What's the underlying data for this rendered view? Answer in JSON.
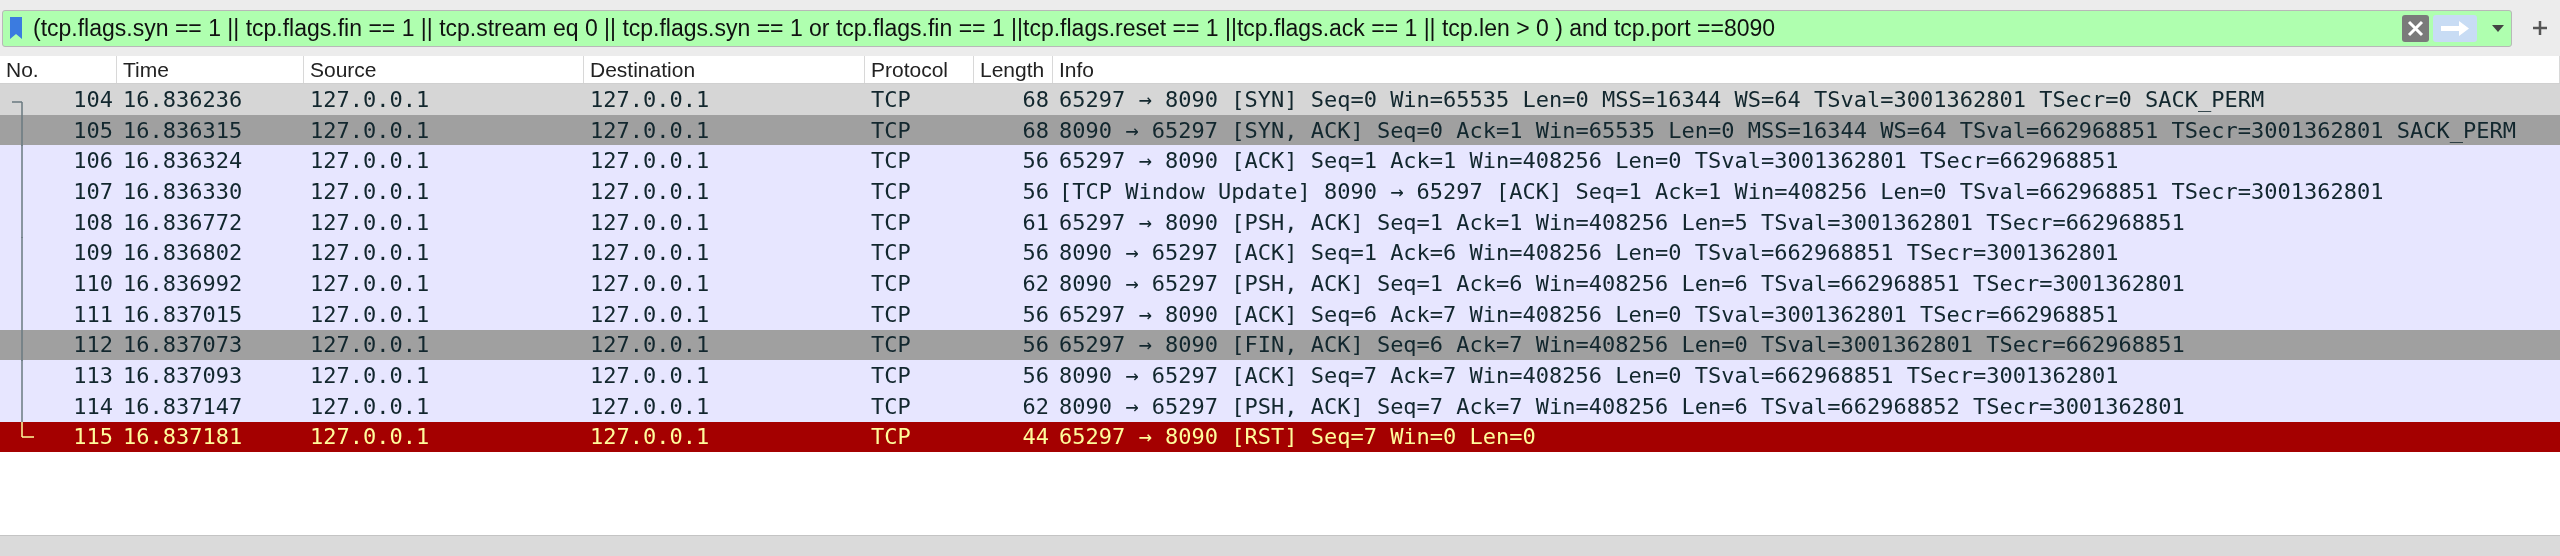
{
  "filter": {
    "value": "(tcp.flags.syn == 1 || tcp.flags.fin == 1 || tcp.stream eq 0 || tcp.flags.syn == 1 or tcp.flags.fin == 1 ||tcp.flags.reset == 1 ||tcp.flags.ack == 1 || tcp.len > 0 ) and tcp.port ==8090",
    "valid": true
  },
  "columns": [
    "No.",
    "Time",
    "Source",
    "Destination",
    "Protocol",
    "Length",
    "Info"
  ],
  "rows": [
    {
      "kind": "syn_fin",
      "hovered": true,
      "cells": [
        "104",
        "16.836236",
        "127.0.0.1",
        "127.0.0.1",
        "TCP",
        "68",
        "65297 → 8090 [SYN] Seq=0 Win=65535 Len=0 MSS=16344 WS=64 TSval=3001362801 TSecr=0 SACK_PERM"
      ]
    },
    {
      "kind": "syn_fin",
      "hovered": false,
      "cells": [
        "105",
        "16.836315",
        "127.0.0.1",
        "127.0.0.1",
        "TCP",
        "68",
        "8090 → 65297 [SYN, ACK] Seq=0 Ack=1 Win=65535 Len=0 MSS=16344 WS=64 TSval=662968851 TSecr=3001362801 SACK_PERM"
      ]
    },
    {
      "kind": "tcp",
      "hovered": false,
      "cells": [
        "106",
        "16.836324",
        "127.0.0.1",
        "127.0.0.1",
        "TCP",
        "56",
        "65297 → 8090 [ACK] Seq=1 Ack=1 Win=408256 Len=0 TSval=3001362801 TSecr=662968851"
      ]
    },
    {
      "kind": "tcp",
      "hovered": false,
      "cells": [
        "107",
        "16.836330",
        "127.0.0.1",
        "127.0.0.1",
        "TCP",
        "56",
        "[TCP Window Update] 8090 → 65297 [ACK] Seq=1 Ack=1 Win=408256 Len=0 TSval=662968851 TSecr=3001362801"
      ]
    },
    {
      "kind": "tcp",
      "hovered": false,
      "cells": [
        "108",
        "16.836772",
        "127.0.0.1",
        "127.0.0.1",
        "TCP",
        "61",
        "65297 → 8090 [PSH, ACK] Seq=1 Ack=1 Win=408256 Len=5 TSval=3001362801 TSecr=662968851"
      ]
    },
    {
      "kind": "tcp",
      "hovered": false,
      "cells": [
        "109",
        "16.836802",
        "127.0.0.1",
        "127.0.0.1",
        "TCP",
        "56",
        "8090 → 65297 [ACK] Seq=1 Ack=6 Win=408256 Len=0 TSval=662968851 TSecr=3001362801"
      ]
    },
    {
      "kind": "tcp",
      "hovered": false,
      "cells": [
        "110",
        "16.836992",
        "127.0.0.1",
        "127.0.0.1",
        "TCP",
        "62",
        "8090 → 65297 [PSH, ACK] Seq=1 Ack=6 Win=408256 Len=6 TSval=662968851 TSecr=3001362801"
      ]
    },
    {
      "kind": "tcp",
      "hovered": false,
      "cells": [
        "111",
        "16.837015",
        "127.0.0.1",
        "127.0.0.1",
        "TCP",
        "56",
        "65297 → 8090 [ACK] Seq=6 Ack=7 Win=408256 Len=0 TSval=3001362801 TSecr=662968851"
      ]
    },
    {
      "kind": "syn_fin",
      "hovered": false,
      "cells": [
        "112",
        "16.837073",
        "127.0.0.1",
        "127.0.0.1",
        "TCP",
        "56",
        "65297 → 8090 [FIN, ACK] Seq=6 Ack=7 Win=408256 Len=0 TSval=3001362801 TSecr=662968851"
      ]
    },
    {
      "kind": "tcp",
      "hovered": false,
      "cells": [
        "113",
        "16.837093",
        "127.0.0.1",
        "127.0.0.1",
        "TCP",
        "56",
        "8090 → 65297 [ACK] Seq=7 Ack=7 Win=408256 Len=0 TSval=662968851 TSecr=3001362801"
      ]
    },
    {
      "kind": "tcp",
      "hovered": false,
      "cells": [
        "114",
        "16.837147",
        "127.0.0.1",
        "127.0.0.1",
        "TCP",
        "62",
        "8090 → 65297 [PSH, ACK] Seq=7 Ack=7 Win=408256 Len=6 TSval=662968852 TSecr=3001362801"
      ]
    },
    {
      "kind": "reset",
      "hovered": false,
      "cells": [
        "115",
        "16.837181",
        "127.0.0.1",
        "127.0.0.1",
        "TCP",
        "44",
        "65297 → 8090 [RST] Seq=7 Win=0 Len=0"
      ]
    }
  ]
}
